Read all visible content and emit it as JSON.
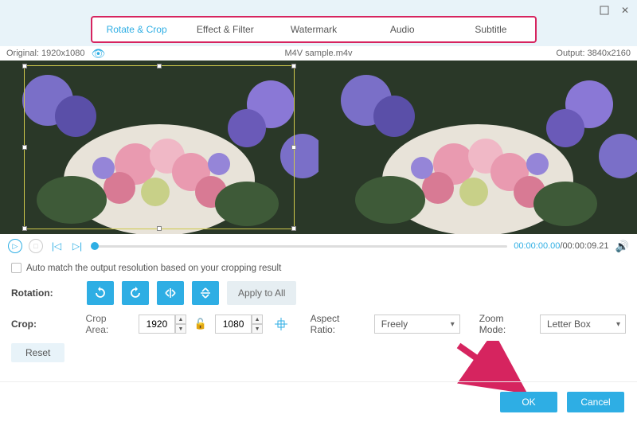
{
  "window": {
    "minimize": "—",
    "close": "✕"
  },
  "tabs": [
    "Rotate & Crop",
    "Effect & Filter",
    "Watermark",
    "Audio",
    "Subtitle"
  ],
  "active_tab": 0,
  "filename": "M4V sample.m4v",
  "original_label": "Original: 1920x1080",
  "output_label": "Output: 3840x2160",
  "playback": {
    "current": "00:00:00.00",
    "total": "00:00:09.21",
    "sep": "/"
  },
  "auto_match_label": "Auto match the output resolution based on your cropping result",
  "rotation_label": "Rotation:",
  "apply_all_label": "Apply to All",
  "crop_label": "Crop:",
  "crop_area_label": "Crop Area:",
  "crop_w": "1920",
  "crop_h": "1080",
  "aspect_label": "Aspect Ratio:",
  "aspect_value": "Freely",
  "zoom_label": "Zoom Mode:",
  "zoom_value": "Letter Box",
  "reset_label": "Reset",
  "ok_label": "OK",
  "cancel_label": "Cancel",
  "colors": {
    "accent": "#2eaee4",
    "highlight": "#d6245f"
  }
}
